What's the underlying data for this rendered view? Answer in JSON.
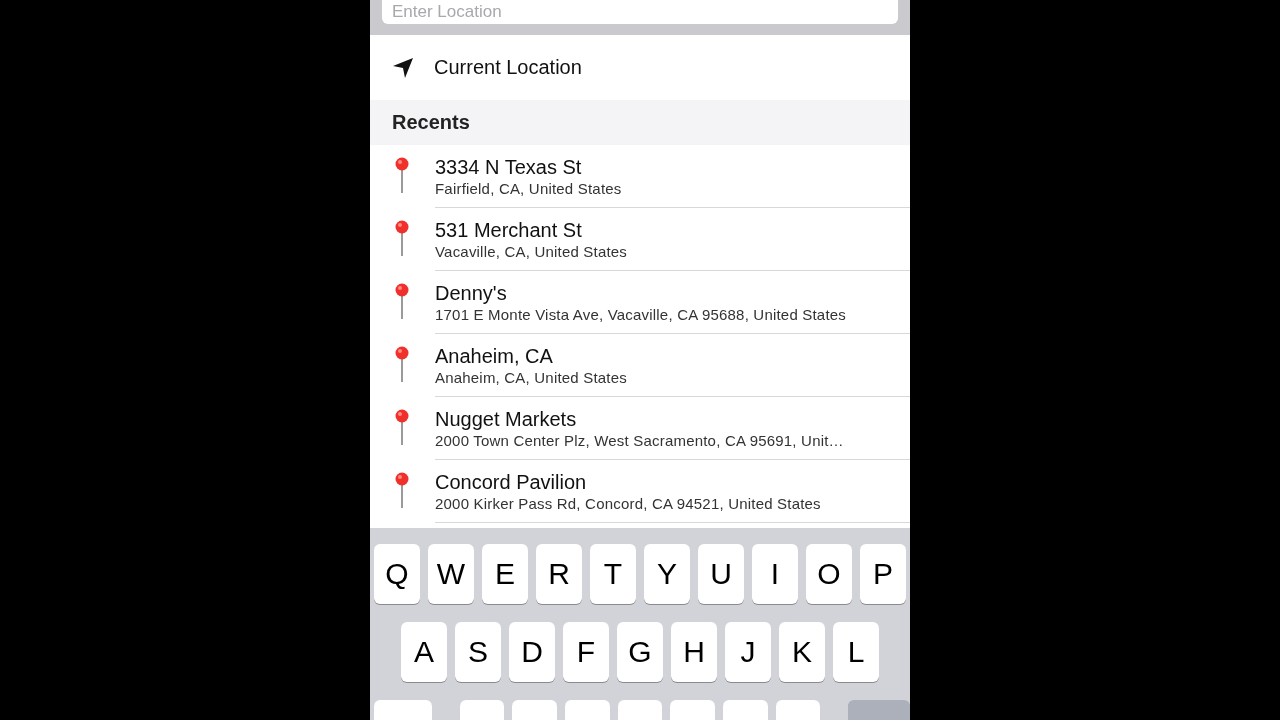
{
  "search": {
    "placeholder": "Enter Location"
  },
  "current_location": {
    "label": "Current Location"
  },
  "recents": {
    "title": "Recents",
    "items": [
      {
        "name": "3334 N Texas St",
        "address": "Fairfield, CA, United States"
      },
      {
        "name": "531 Merchant St",
        "address": "Vacaville, CA, United States"
      },
      {
        "name": "Denny's",
        "address": "1701 E Monte Vista Ave, Vacaville, CA  95688, United States"
      },
      {
        "name": "Anaheim, CA",
        "address": "Anaheim, CA, United States"
      },
      {
        "name": "Nugget Markets",
        "address": "2000 Town Center Plz, West Sacramento, CA  95691, Unit…"
      },
      {
        "name": "Concord Pavilion",
        "address": "2000 Kirker Pass Rd, Concord, CA  94521, United States"
      }
    ]
  },
  "keyboard": {
    "rows": [
      [
        "Q",
        "W",
        "E",
        "R",
        "T",
        "Y",
        "U",
        "I",
        "O",
        "P"
      ],
      [
        "A",
        "S",
        "D",
        "F",
        "G",
        "H",
        "J",
        "K",
        "L"
      ]
    ]
  }
}
